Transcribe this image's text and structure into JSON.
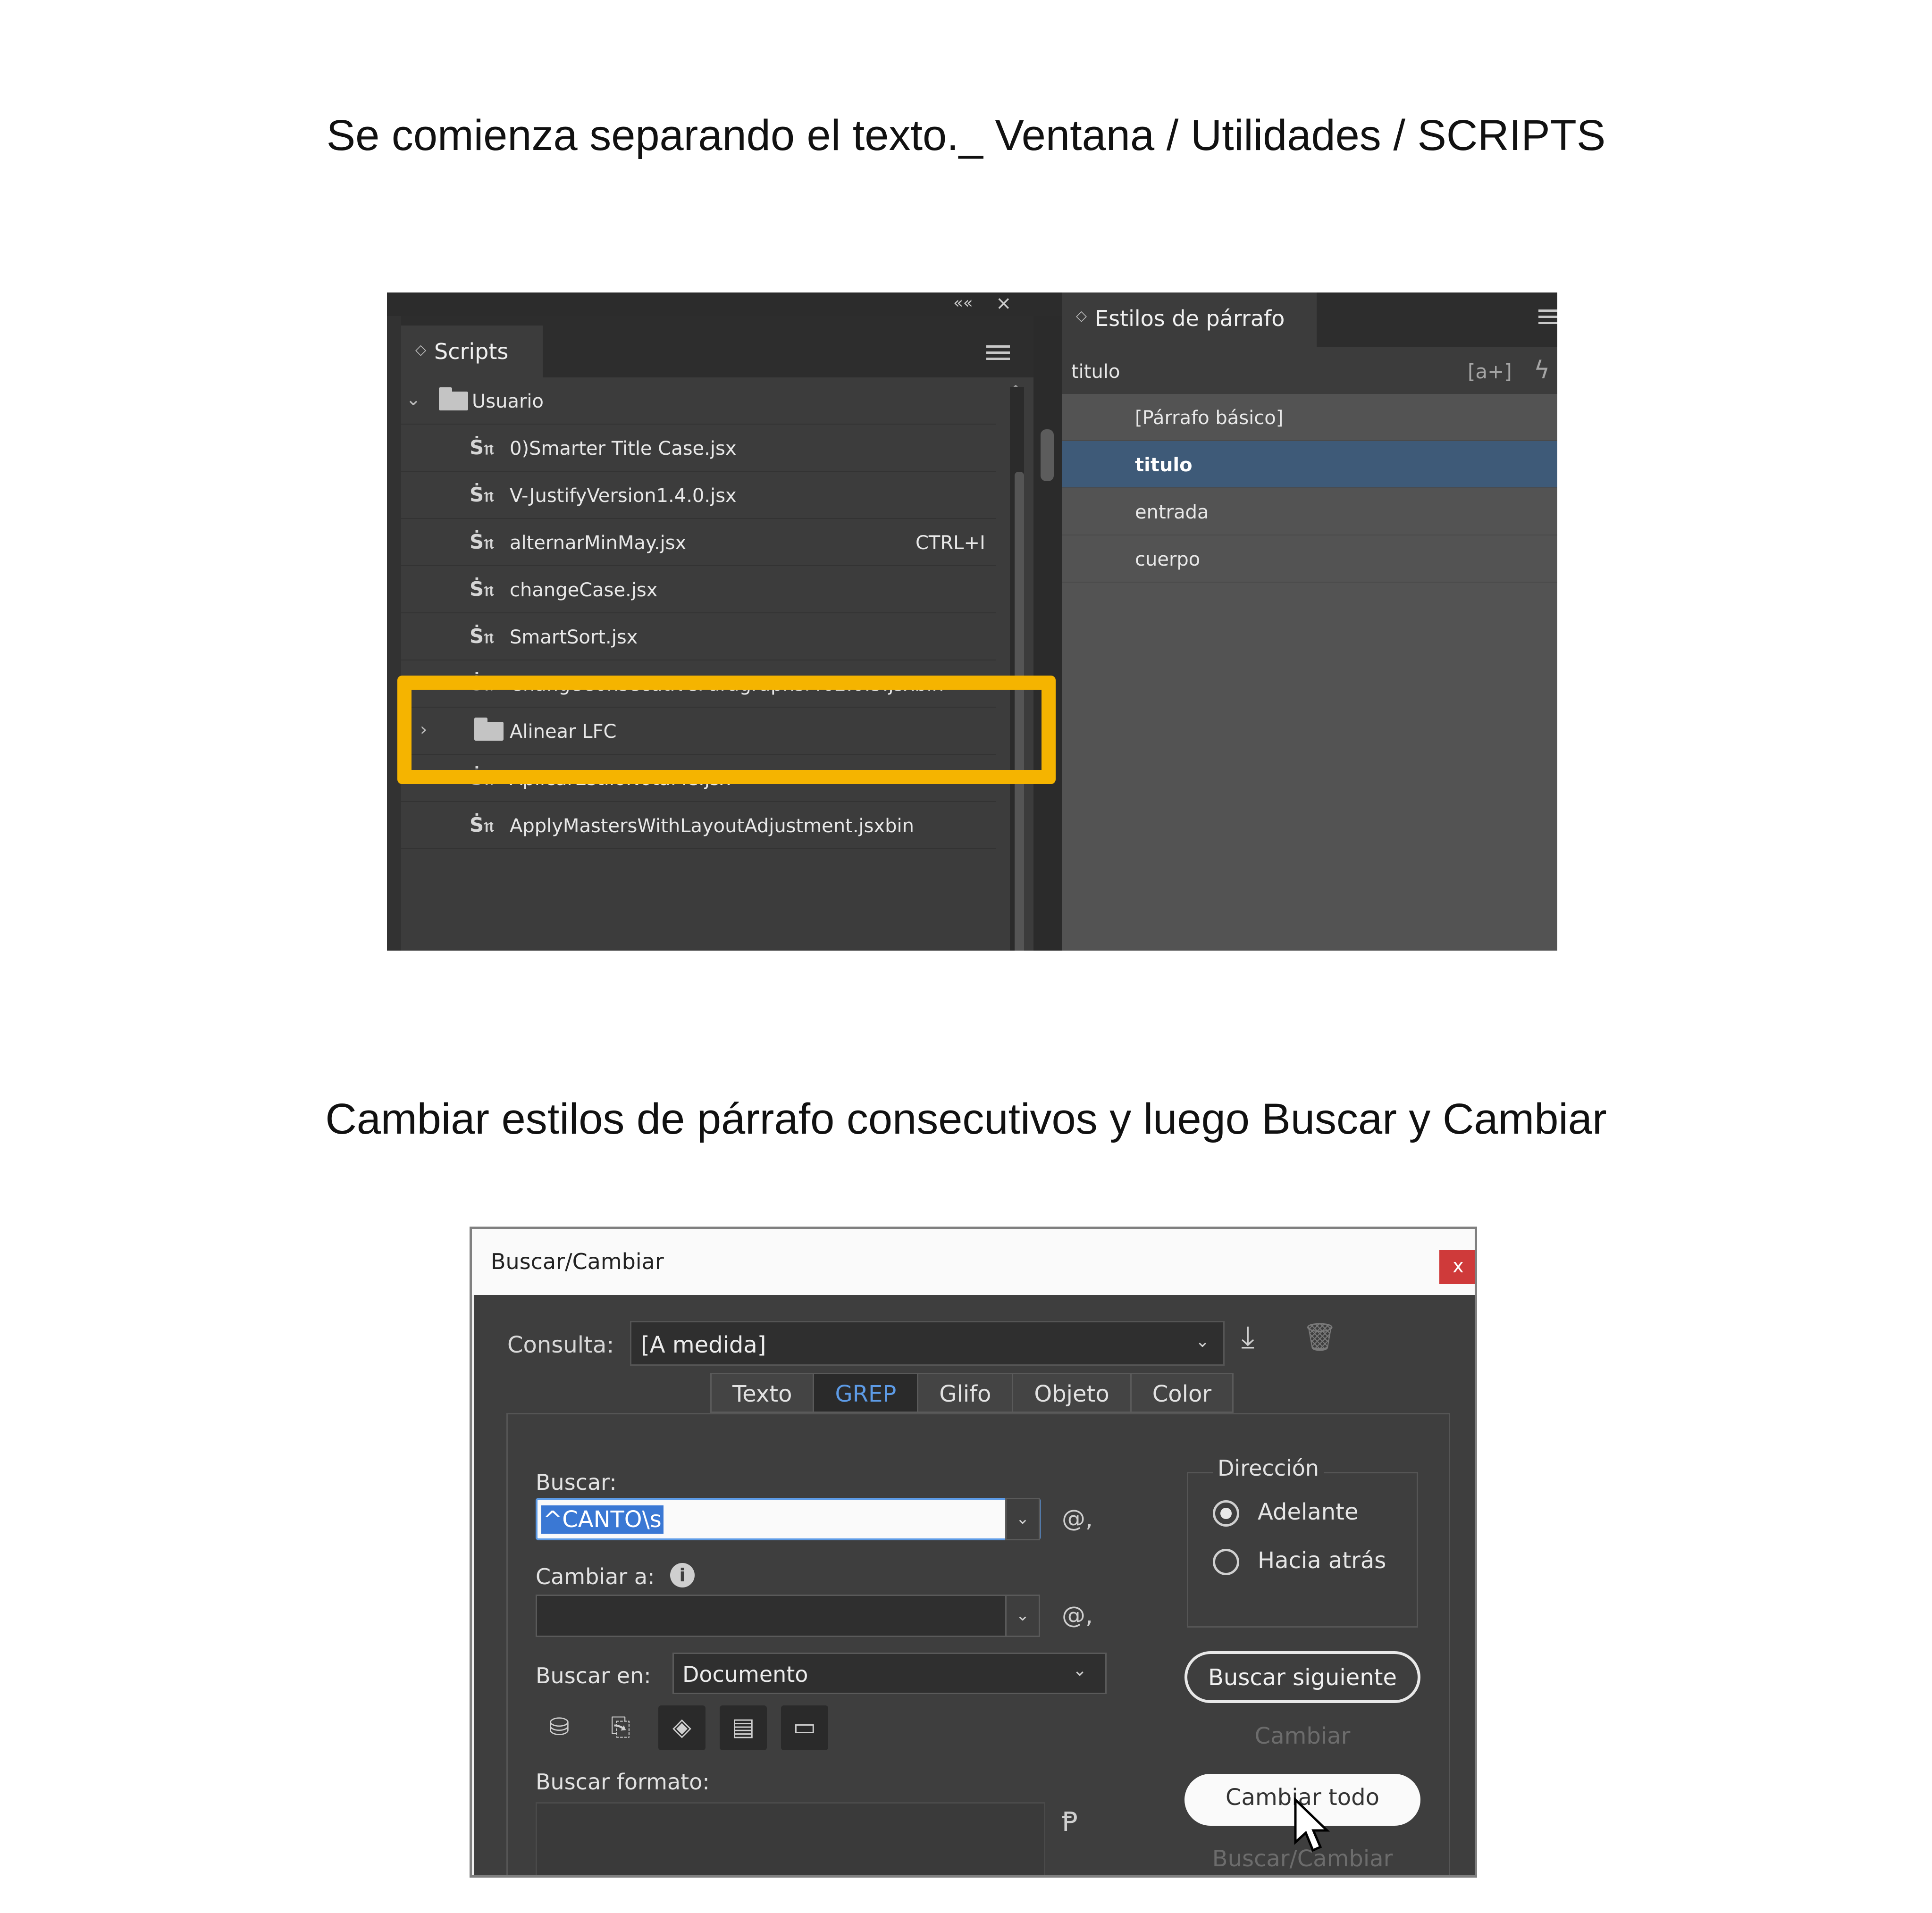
{
  "captions": {
    "first": "Se comienza separando el texto._ Ventana / Utilidades / SCRIPTS",
    "second": "Cambiar estilos de párrafo consecutivos y luego Buscar y Cambiar"
  },
  "scripts_panel": {
    "tab_label": "Scripts",
    "tab_arrows": "◇",
    "items": [
      {
        "type": "folder",
        "label": "Usuario",
        "expanded": true
      },
      {
        "type": "script",
        "label": "0)Smarter Title Case.jsx"
      },
      {
        "type": "script",
        "label": "V-JustifyVersion1.4.0.jsx"
      },
      {
        "type": "script",
        "label": "alternarMinMay.jsx",
        "shortcut": "CTRL+I"
      },
      {
        "type": "script",
        "label": "changeCase.jsx"
      },
      {
        "type": "script",
        "label": "SmartSort.jsx"
      },
      {
        "type": "script",
        "label": "ChangeConsecutiveParagraphsPro2.0.5.jsxbin",
        "highlighted": true
      },
      {
        "type": "folder",
        "label": "Alinear LFC",
        "expanded": false
      },
      {
        "type": "script",
        "label": "AplicarEstiloNotaPie.jsx"
      },
      {
        "type": "script",
        "label": "ApplyMastersWithLayoutAdjustment.jsxbin"
      }
    ],
    "script_icon": "Ṡ𝔫",
    "highlight_color": "#f5b400"
  },
  "styles_panel": {
    "tab_label": "Estilos de párrafo",
    "current_style": "titulo",
    "new_style_icon": "[a+]",
    "lightning_icon": "ϟ",
    "styles": [
      {
        "label": "[Párrafo básico]",
        "selected": false
      },
      {
        "label": "titulo",
        "selected": true
      },
      {
        "label": "entrada",
        "selected": false
      },
      {
        "label": "cuerpo",
        "selected": false
      }
    ],
    "selected_color": "#3e5a78"
  },
  "find_change": {
    "title": "Buscar/Cambiar",
    "close_label": "x",
    "query_label": "Consulta:",
    "query_value": "[A medida]",
    "tabs": [
      {
        "label": "Texto",
        "active": false
      },
      {
        "label": "GREP",
        "active": true
      },
      {
        "label": "Glifo",
        "active": false
      },
      {
        "label": "Objeto",
        "active": false
      },
      {
        "label": "Color",
        "active": false
      }
    ],
    "find_label": "Buscar:",
    "find_value": "^CANTO\\s",
    "change_label": "Cambiar a:",
    "change_value": "",
    "info_icon": "i",
    "at_symbol": "@,",
    "search_in_label": "Buscar en:",
    "search_in_value": "Documento",
    "find_format_label": "Buscar formato:",
    "direction_label": "Dirección",
    "direction_options": [
      {
        "label": "Adelante",
        "selected": true
      },
      {
        "label": "Hacia atrás",
        "selected": false
      }
    ],
    "buttons": {
      "find_next": "Buscar siguiente",
      "change": "Cambiar",
      "change_all": "Cambiar todo",
      "find_change": "Buscar/Cambiar"
    },
    "active_tab_color": "#5d9be6",
    "selection_color": "#3a78d4"
  }
}
